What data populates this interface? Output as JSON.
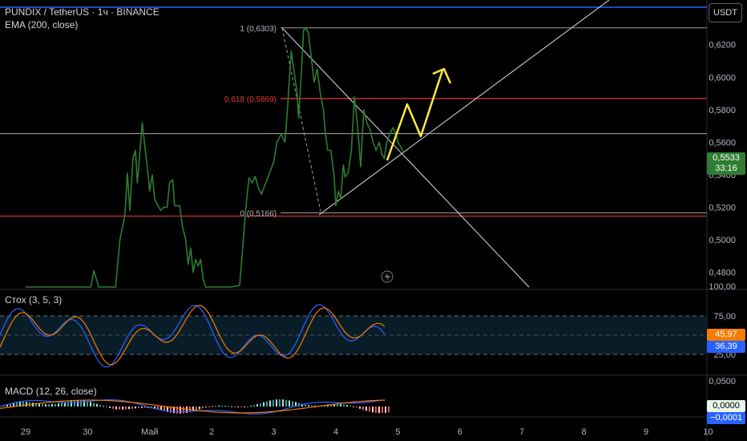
{
  "header": {
    "symbol_line": "PUNDIX / TetherUS · 1ч · BINANCE",
    "indicator_line": "EMA (200, close)",
    "unit_button": "USDT"
  },
  "price_tag": {
    "price": "0,5533",
    "countdown": "33:16",
    "color": "#2e7d32"
  },
  "fib_labels": {
    "top": "1 (0,6303)",
    "mid": "0,618 (0,5869)",
    "bottom": "0 (0,5166)"
  },
  "stoch": {
    "label": "Стох (3, 5, 3)",
    "k_tag": "45,97",
    "d_tag": "36,39",
    "axis_labels": [
      "100,00",
      "75,00",
      "25,00"
    ],
    "k_color": "#f57c00",
    "d_color": "#2962ff"
  },
  "macd": {
    "label": "MACD (12, 26, close)",
    "axis_labels": [
      "0,0500"
    ],
    "tag_zero": "0,0000",
    "tag_neg": "−0,0001"
  },
  "colors": {
    "price_line": "#2e7d32",
    "fib_red": "#e53935",
    "fib_gray": "#9e9e9e",
    "forecast": "#ffeb3b",
    "ema": "#2962ff"
  },
  "chart_data": {
    "type": "line",
    "x_ticks": [
      "29",
      "30",
      "Май",
      "2",
      "3",
      "4",
      "5",
      "6",
      "7",
      "8",
      "9",
      "10"
    ],
    "y_ticks": [
      "0,6200",
      "0,6000",
      "0,5800",
      "0,5600",
      "0,5400",
      "0,5200",
      "0,5000",
      "0,4800"
    ],
    "ylim": [
      0.471,
      0.6435
    ],
    "fib_levels": [
      0.6303,
      0.5869,
      0.5166
    ],
    "horizontal_levels": [
      0.5653,
      0.5146
    ],
    "series": [
      {
        "values": [
          [
            0.0,
            0.471
          ],
          [
            1.05,
            0.471
          ],
          [
            1.1,
            0.481
          ],
          [
            1.18,
            0.471
          ],
          [
            1.3,
            0.471
          ],
          [
            1.45,
            0.471
          ],
          [
            1.52,
            0.5
          ],
          [
            1.6,
            0.515
          ],
          [
            1.64,
            0.541
          ],
          [
            1.68,
            0.518
          ],
          [
            1.73,
            0.55
          ],
          [
            1.77,
            0.555
          ],
          [
            1.8,
            0.535
          ],
          [
            1.84,
            0.553
          ],
          [
            1.88,
            0.572
          ],
          [
            1.92,
            0.558
          ],
          [
            1.96,
            0.545
          ],
          [
            2.0,
            0.53
          ],
          [
            2.04,
            0.54
          ],
          [
            2.08,
            0.525
          ],
          [
            2.12,
            0.522
          ],
          [
            2.18,
            0.518
          ],
          [
            2.22,
            0.52
          ],
          [
            2.28,
            0.52
          ],
          [
            2.32,
            0.535
          ],
          [
            2.37,
            0.537
          ],
          [
            2.4,
            0.521
          ],
          [
            2.48,
            0.521
          ],
          [
            2.53,
            0.508
          ],
          [
            2.58,
            0.5
          ],
          [
            2.62,
            0.485
          ],
          [
            2.66,
            0.495
          ],
          [
            2.7,
            0.48
          ],
          [
            2.74,
            0.488
          ],
          [
            2.78,
            0.484
          ],
          [
            2.82,
            0.488
          ],
          [
            2.86,
            0.476
          ],
          [
            2.9,
            0.471
          ],
          [
            2.94,
            0.471
          ],
          [
            3.3,
            0.471
          ],
          [
            3.45,
            0.472
          ],
          [
            3.55,
            0.52
          ],
          [
            3.6,
            0.538
          ],
          [
            3.65,
            0.535
          ],
          [
            3.7,
            0.539
          ],
          [
            3.75,
            0.532
          ],
          [
            3.8,
            0.528
          ],
          [
            3.9,
            0.538
          ],
          [
            4.0,
            0.548
          ],
          [
            4.05,
            0.56
          ],
          [
            4.12,
            0.565
          ],
          [
            4.18,
            0.56
          ],
          [
            4.22,
            0.58
          ],
          [
            4.28,
            0.616
          ],
          [
            4.32,
            0.605
          ],
          [
            4.37,
            0.592
          ],
          [
            4.4,
            0.575
          ],
          [
            4.44,
            0.6
          ],
          [
            4.48,
            0.629
          ],
          [
            4.52,
            0.63
          ],
          [
            4.56,
            0.627
          ],
          [
            4.6,
            0.614
          ],
          [
            4.65,
            0.597
          ],
          [
            4.7,
            0.605
          ],
          [
            4.75,
            0.59
          ],
          [
            4.8,
            0.58
          ],
          [
            4.83,
            0.566
          ],
          [
            4.87,
            0.555
          ],
          [
            4.92,
            0.555
          ],
          [
            4.97,
            0.54
          ],
          [
            5.0,
            0.521
          ],
          [
            5.04,
            0.53
          ],
          [
            5.08,
            0.525
          ],
          [
            5.12,
            0.546
          ],
          [
            5.15,
            0.5385
          ],
          [
            5.2,
            0.5415
          ],
          [
            5.25,
            0.555
          ],
          [
            5.3,
            0.588
          ],
          [
            5.35,
            0.57
          ],
          [
            5.4,
            0.545
          ],
          [
            5.45,
            0.58
          ],
          [
            5.5,
            0.572
          ],
          [
            5.55,
            0.568
          ],
          [
            5.6,
            0.56
          ],
          [
            5.65,
            0.555
          ],
          [
            5.7,
            0.56
          ],
          [
            5.74,
            0.553
          ],
          [
            5.78,
            0.55
          ],
          [
            5.82,
            0.56
          ],
          [
            5.87,
            0.565
          ],
          [
            5.92,
            0.569
          ],
          [
            5.97,
            0.565
          ],
          [
            6.0,
            0.56
          ],
          [
            6.05,
            0.557
          ],
          [
            6.1,
            0.5533
          ]
        ]
      }
    ]
  }
}
